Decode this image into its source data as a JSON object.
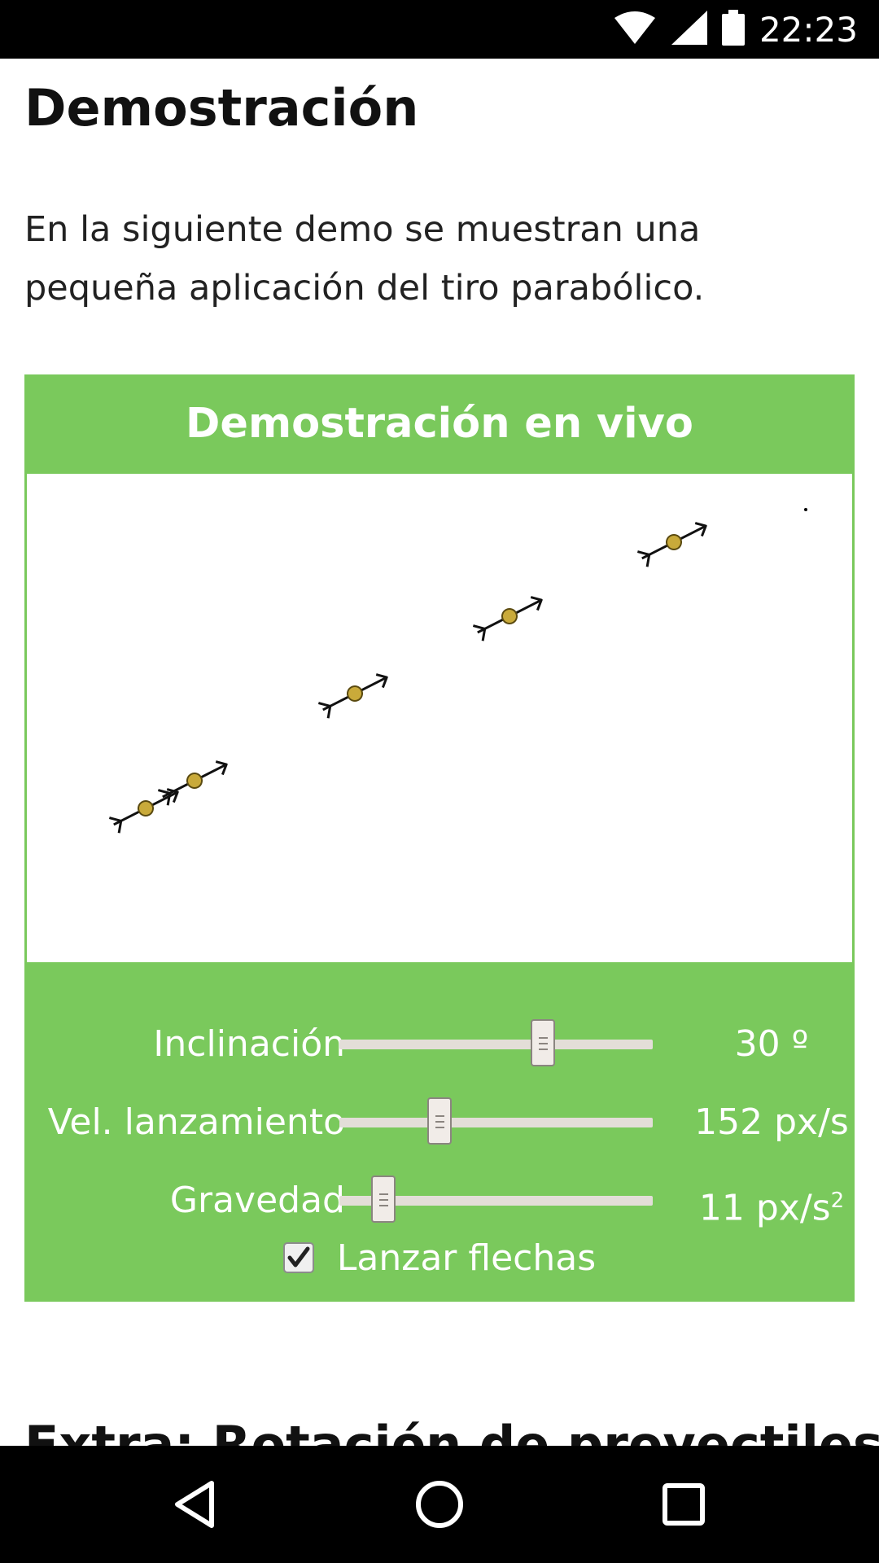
{
  "status_bar": {
    "time": "22:23",
    "icons": [
      "wifi-icon",
      "cell-signal-icon",
      "battery-icon"
    ]
  },
  "page": {
    "title": "Demostración",
    "intro": "En la siguiente demo se muestran una pequeña aplicación del tiro parabólico."
  },
  "demo": {
    "title": "Demostración en vivo",
    "accent_color": "#7ac95c",
    "projectile_color": "#c9aa3a",
    "controls": [
      {
        "label": "Inclinación",
        "value": "30 º",
        "position": 0.65
      },
      {
        "label": "Vel. lanzamiento",
        "value": "152 px/s",
        "position": 0.32
      },
      {
        "label": "Gravedad",
        "value": "11 px/s",
        "value_sup": "2",
        "position": 0.14
      }
    ],
    "checkbox": {
      "label": "Lanzar flechas",
      "checked": true
    }
  },
  "next_section": {
    "heading": "Extra: Rotación de proyectiles"
  },
  "nav_bar": {
    "buttons": [
      "back-icon",
      "home-icon",
      "recents-icon"
    ]
  }
}
